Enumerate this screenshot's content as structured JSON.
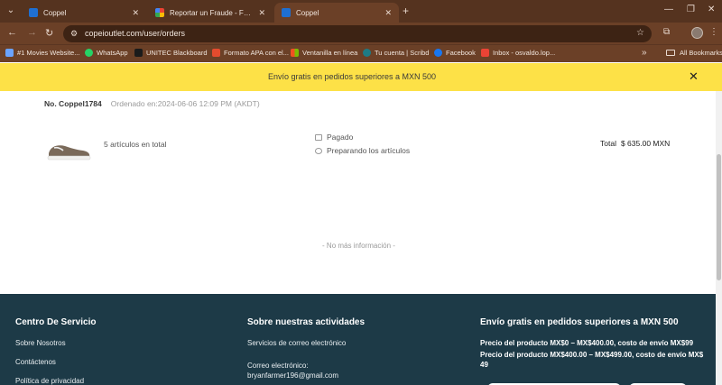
{
  "browser": {
    "tabs": [
      {
        "title": "Coppel",
        "active": false
      },
      {
        "title": "Reportar un Fraude - Formulario",
        "active": false
      },
      {
        "title": "Coppel",
        "active": true
      }
    ],
    "url": "copeioutlet.com/user/orders",
    "bookmarks": [
      {
        "label": "#1 Movies Website...",
        "icon": "movies-icon",
        "color": "#6aa3ff"
      },
      {
        "label": "WhatsApp",
        "icon": "whatsapp-icon",
        "color": "#25d366"
      },
      {
        "label": "UNITEC Blackboard",
        "icon": "blackboard-icon",
        "color": "#1b1b1b"
      },
      {
        "label": "Formato APA con el...",
        "icon": "apa-icon",
        "color": "#e44b2e"
      },
      {
        "label": "Ventanilla en línea",
        "icon": "windows-icon",
        "color": "#f25022"
      },
      {
        "label": "Tu cuenta | Scribd",
        "icon": "scribd-icon",
        "color": "#1e7b85"
      },
      {
        "label": "Facebook",
        "icon": "facebook-icon",
        "color": "#1877f2"
      },
      {
        "label": "Inbox - osvaldo.lop...",
        "icon": "gmail-icon",
        "color": "#ea4335"
      }
    ],
    "all_bookmarks": "All Bookmarks"
  },
  "banner": {
    "text": "Envío gratis en pedidos superiores a MXN 500"
  },
  "order": {
    "number": "No. Coppel1784",
    "date": "Ordenado en:2024-06-06 12:09 PM (AKDT)",
    "items_total": "5 artículos en total",
    "status_paid": "Pagado",
    "status_prep": "Preparando los artículos",
    "total_label": "Total",
    "total_value": "$ 635.00 MXN",
    "no_more": "- No más información -"
  },
  "footer": {
    "col1": {
      "title": "Centro De Servicio",
      "links": [
        "Sobre Nosotros",
        "Contáctenos",
        "Política de privacidad"
      ]
    },
    "col2": {
      "title": "Sobre nuestras actividades",
      "links": [
        "Servicios de correo electrónico",
        "Correo electrónico:",
        "bryanfarmer196@gmail.com"
      ]
    },
    "col3": {
      "title": "Envío gratis en pedidos superiores a MXN 500",
      "lines": [
        "Precio del producto MX$0 – MX$400.00, costo de envío MX$99",
        "Precio del producto MX$400.00 – MX$499.00, costo de envío MX$ 49"
      ]
    }
  },
  "colors": {
    "banner": "#fde147",
    "footer": "#1d3a47",
    "chrome": "#6b4027"
  }
}
